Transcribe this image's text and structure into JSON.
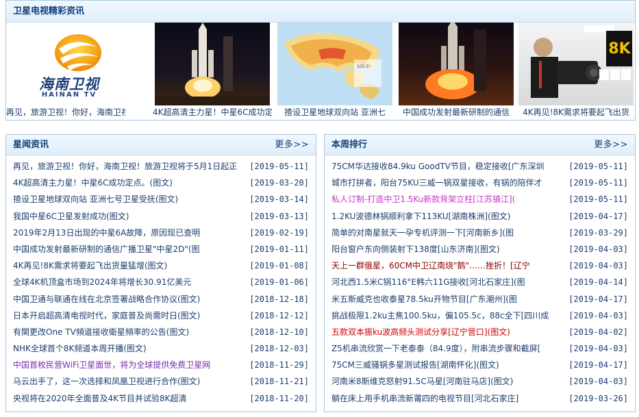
{
  "sat": {
    "title": "卫星电视精彩资讯",
    "items": [
      {
        "caption": "再见，旅游卫视！你好，海南卫视！旅",
        "logo_text": "海南卫视",
        "logo_sub": "HAINAN TV"
      },
      {
        "caption": "4K超高清主力星！中星6C成功定"
      },
      {
        "caption": "揸设卫星地球双向站 亚洲七"
      },
      {
        "caption": "中国成功发射最新研制的通信"
      },
      {
        "caption": "4K再见!8K需求将要起飞出货",
        "badge": "8K"
      }
    ]
  },
  "news": {
    "title": "星闻资讯",
    "more": "更多>>",
    "items": [
      {
        "text": "再见，旅游卫视！你好，海南卫视！旅游卫视将于5月1日起正",
        "date": "[2019-05-11]",
        "color": "#1a3c6e"
      },
      {
        "text": "4K超高清主力星！中星6C成功定点。(图文)",
        "date": "[2019-03-20]",
        "color": "#1a3c6e"
      },
      {
        "text": "揸设卫星地球双向站 亚洲七号卫星受抚(图文)",
        "date": "[2019-03-14]",
        "color": "#1a3c6e"
      },
      {
        "text": "我国中星6C卫星发射成功(图文)",
        "date": "[2019-03-13]",
        "color": "#1a3c6e"
      },
      {
        "text": "2019年2月13日出现的中星6A故障，原因现已查明",
        "date": "[2019-02-19]",
        "color": "#1a3c6e"
      },
      {
        "text": "中国成功发射最新研制的通信广播卫星\"中星2D\"(图",
        "date": "[2019-01-11]",
        "color": "#1a3c6e"
      },
      {
        "text": "4K再见!8K需求将要起飞出货量猛增(图文)",
        "date": "[2019-01-08]",
        "color": "#1a3c6e"
      },
      {
        "text": "全球4K机顶盒市场到2024年将增长30.91亿美元",
        "date": "[2019-01-06]",
        "color": "#1a3c6e"
      },
      {
        "text": "中国卫通与联通在线在北京签署战略合作协议(图文)",
        "date": "[2018-12-18]",
        "color": "#1a3c6e"
      },
      {
        "text": "日本开启超高清电视时代，家庭普及尚需时日(图文)",
        "date": "[2018-12-12]",
        "color": "#1a3c6e"
      },
      {
        "text": "有関更改One TV頻道接收衛星頻率的公告(图文)",
        "date": "[2018-12-10]",
        "color": "#1a3c6e"
      },
      {
        "text": "NHK全球首个8K频道本周开播(图文)",
        "date": "[2018-12-03]",
        "color": "#1a3c6e"
      },
      {
        "text": "中国首枚民营WiFi卫星面世，将为全球提供免费卫星网",
        "date": "[2018-11-29]",
        "color": "#7a2fb0"
      },
      {
        "text": "马云出手了，这一次选择和凤凰卫视进行合作(图文)",
        "date": "[2018-11-21]",
        "color": "#1a3c6e"
      },
      {
        "text": "央视将在2020年全面普及4K节目并试验8K超清",
        "date": "[2018-11-20]",
        "color": "#1a3c6e"
      }
    ]
  },
  "rank": {
    "title": "本周排行",
    "more": "更多>>",
    "items": [
      {
        "text": "75CM华达接收84.9ku GoodTV节目，稳定接收[广东深圳",
        "date": "[2019-05-11]",
        "color": "#1a3c6e"
      },
      {
        "text": "城市打拼者，阳台75KU三威一锅双星接收，有锅的陪伴才",
        "date": "[2019-05-11]",
        "color": "#1a3c6e"
      },
      {
        "text": "私人订制-打造中卫1.5Ku新款背架立柱[江苏镇江](",
        "date": "[2019-05-11]",
        "color": "#cc33cc"
      },
      {
        "text": "1.2KU波德林锅顺利拿下113KU[湖南株洲](图文)",
        "date": "[2019-04-17]",
        "color": "#1a3c6e"
      },
      {
        "text": "简单的对南星就天一孕专机评测一下[河南新乡](图",
        "date": "[2019-03-29]",
        "color": "#1a3c6e"
      },
      {
        "text": "阳台窗户东向侧装射下138度[山东济南](图文)",
        "date": "[2019-04-03]",
        "color": "#1a3c6e"
      },
      {
        "text": "天上一群俄星，60CM中卫辽南烧\"鹅\"……挫折！[辽宁",
        "date": "[2019-04-03]",
        "color": "#8b0000"
      },
      {
        "text": "河北西1.5米C锅116°E韩六11G接收[河北石家庄](图",
        "date": "[2019-04-14]",
        "color": "#1a3c6e"
      },
      {
        "text": "米五斯威克也收泰星78.5ku开物节目[广东潮州](图",
        "date": "[2019-04-17]",
        "color": "#1a3c6e"
      },
      {
        "text": "挑战极限1.2ku主焦100.5ku，偏105.5c，88c全下[四川成",
        "date": "[2019-04-03]",
        "color": "#1a3c6e"
      },
      {
        "text": "五款双本振ku波高频头测试分享[辽宁营口](图文)",
        "date": "[2019-04-02]",
        "color": "#cc0000"
      },
      {
        "text": "Z5机串流欣赏一下老泰泰（84.9度），附串流步骤和截屏[",
        "date": "[2019-04-03]",
        "color": "#1a3c6e"
      },
      {
        "text": "75CM三威骚锅多星测试报告[湖南怀化](图文)",
        "date": "[2019-04-17]",
        "color": "#1a3c6e"
      },
      {
        "text": "河南米8斯维克怒射91.5C马星[河南驻马店](图文)",
        "date": "[2019-04-03]",
        "color": "#1a3c6e"
      },
      {
        "text": "躺在床上用手机串流新莆四的电视节目[河北石家庄]",
        "date": "[2019-03-26]",
        "color": "#1a3c6e"
      }
    ]
  }
}
